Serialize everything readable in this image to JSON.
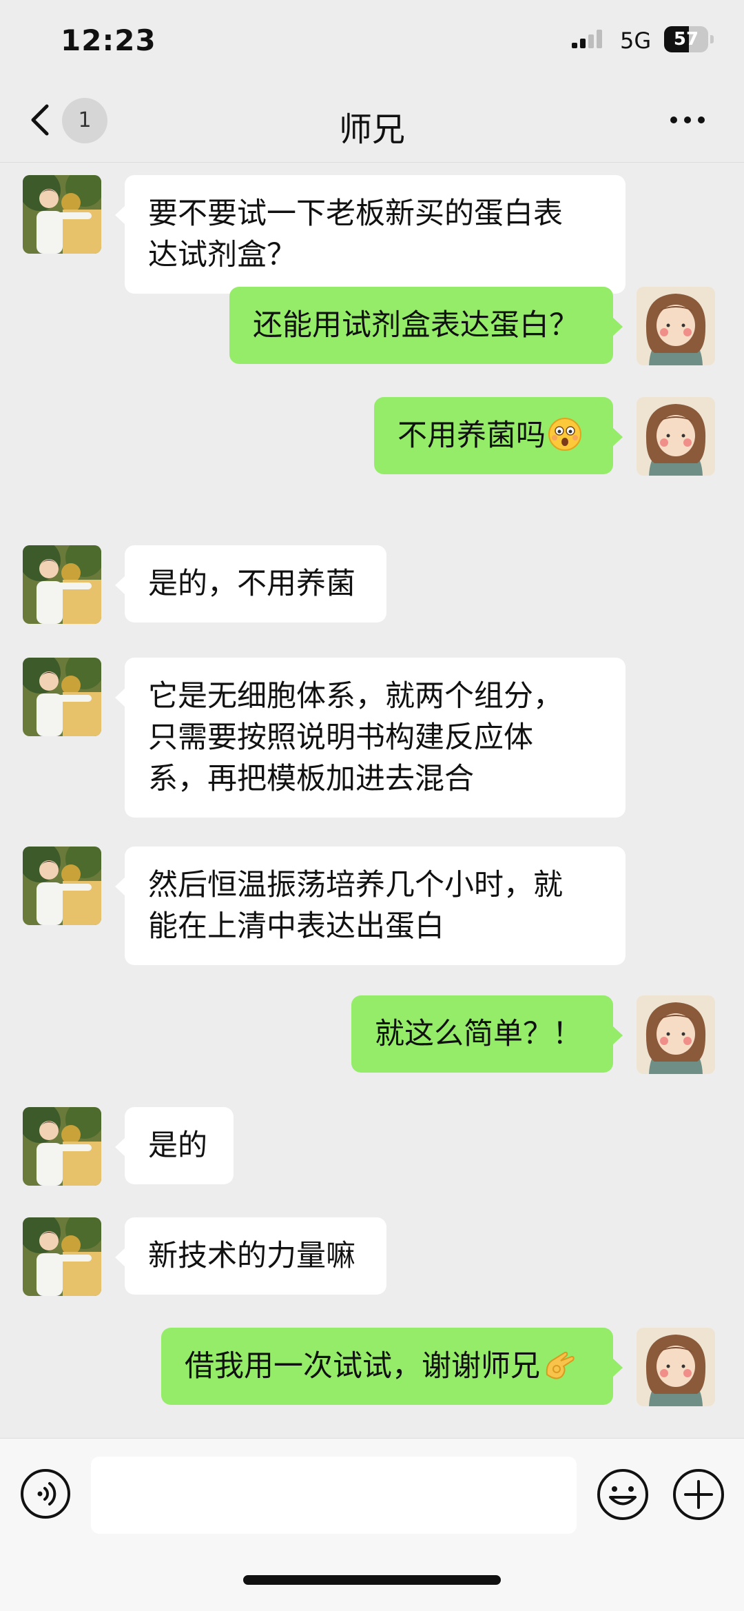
{
  "status_bar": {
    "time": "12:23",
    "network": "5G",
    "battery": "57",
    "battery_level": 0.57
  },
  "nav": {
    "unread_count": "1",
    "title": "师兄"
  },
  "messages": [
    {
      "side": "in",
      "text": "要不要试一下老板新买的蛋白表\n达试剂盒？"
    },
    {
      "side": "out",
      "text": "还能用试剂盒表达蛋白？"
    },
    {
      "side": "out",
      "text": "不用养菌吗",
      "emoji": "astonished-face"
    },
    {
      "side": "in",
      "text": "是的，不用养菌"
    },
    {
      "side": "in",
      "text": "它是无细胞体系，就两个组分，\n只需要按照说明书构建反应体\n系，再把模板加进去混合"
    },
    {
      "side": "in",
      "text": "然后恒温振荡培养几个小时，就\n能在上清中表达出蛋白"
    },
    {
      "side": "out",
      "text": "就这么简单？！"
    },
    {
      "side": "in",
      "text": "是的"
    },
    {
      "side": "in",
      "text": "新技术的力量嘛"
    },
    {
      "side": "out",
      "text": "借我用一次试试，谢谢师兄",
      "emoji": "ok-hand"
    }
  ],
  "input_bar": {
    "placeholder": "",
    "value": ""
  },
  "colors": {
    "background": "#ededed",
    "incoming_bubble": "#ffffff",
    "outgoing_bubble": "#95ec69"
  }
}
